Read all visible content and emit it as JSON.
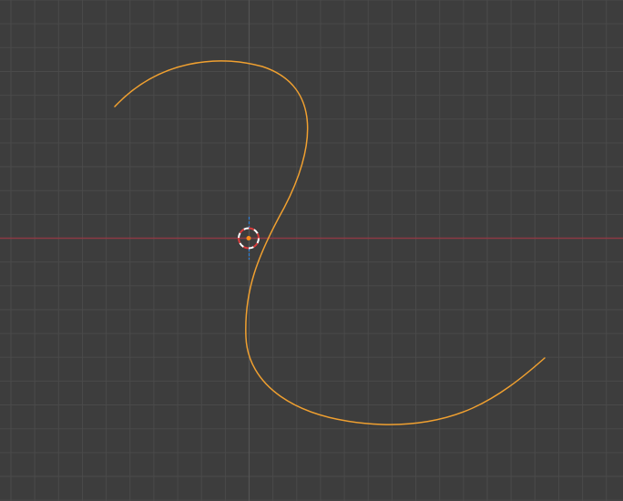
{
  "viewport": {
    "background_color": "#3d3d3d",
    "grid_color": "#4a4a4a",
    "axis_x_color": "#8c3a44",
    "axis_y_color": "#4e4e4e",
    "selection_color": "#f0a030",
    "origin_color": "#ff8c1a",
    "cursor_colors": [
      "#ffffff",
      "#d93b3b"
    ],
    "gizmo_axis_color": "#2f7fd6"
  },
  "objects": [
    {
      "type": "bezier-curve",
      "selected": true
    }
  ],
  "cursor": {
    "name": "3d-cursor"
  }
}
